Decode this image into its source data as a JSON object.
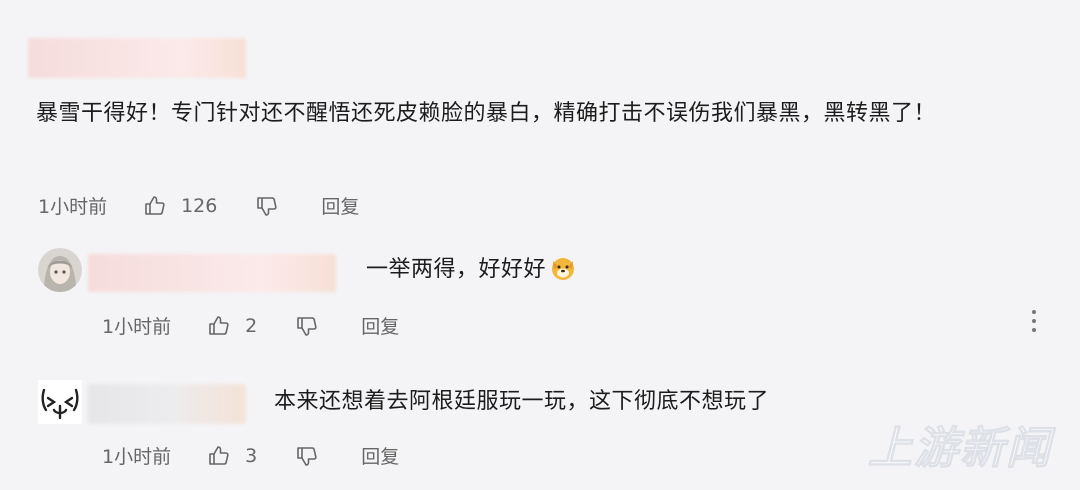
{
  "comments": [
    {
      "text": "暴雪干得好！专门针对还不醒悟还死皮赖脸的暴白，精确打击不误伤我们暴黑，黑转黑了！",
      "time": "1小时前",
      "likes": "126",
      "reply_label": "回复"
    }
  ],
  "replies": [
    {
      "text": "一举两得，好好好",
      "emoji": "dog-face-emoji",
      "time": "1小时前",
      "likes": "2",
      "reply_label": "回复"
    },
    {
      "text": "本来还想着去阿根廷服玩一玩，这下彻底不想玩了",
      "time": "1小时前",
      "likes": "3",
      "reply_label": "回复"
    }
  ],
  "watermark": "上游新闻"
}
